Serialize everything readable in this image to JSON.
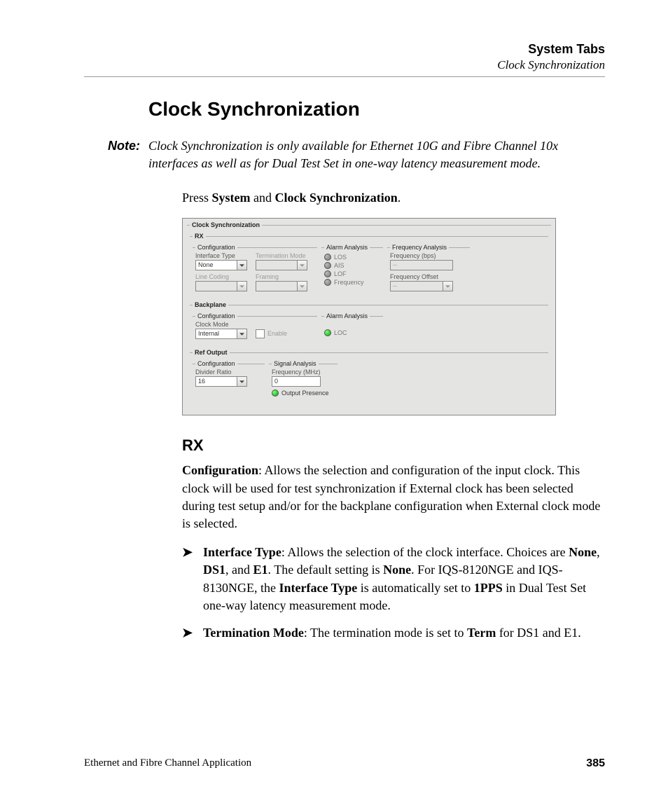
{
  "header": {
    "title": "System Tabs",
    "subtitle": "Clock Synchronization"
  },
  "heading": "Clock Synchronization",
  "note": {
    "label": "Note:",
    "text": "Clock Synchronization is only available for Ethernet 10G and Fibre Channel 10x interfaces as well as for Dual Test Set in one-way latency measurement mode."
  },
  "press": {
    "pre": "Press ",
    "b1": "System",
    "mid": " and ",
    "b2": "Clock Synchronization",
    "post": "."
  },
  "ui": {
    "panel_title": "Clock Synchronization",
    "rx": {
      "title": "RX",
      "config": {
        "legend": "Configuration",
        "interface_type_label": "Interface Type",
        "interface_type_value": "None",
        "termination_mode_label": "Termination Mode",
        "termination_mode_value": "",
        "line_coding_label": "Line Coding",
        "line_coding_value": "",
        "framing_label": "Framing",
        "framing_value": ""
      },
      "alarm": {
        "legend": "Alarm Analysis",
        "items": [
          "LOS",
          "AIS",
          "LOF",
          "Frequency"
        ]
      },
      "freq": {
        "legend": "Frequency Analysis",
        "bps_label": "Frequency (bps)",
        "bps_value": "--",
        "offset_label": "Frequency Offset",
        "offset_value": "--"
      }
    },
    "backplane": {
      "title": "Backplane",
      "config": {
        "legend": "Configuration",
        "clock_mode_label": "Clock Mode",
        "clock_mode_value": "Internal",
        "enable_label": "Enable"
      },
      "alarm": {
        "legend": "Alarm Analysis",
        "item": "LOC"
      }
    },
    "refout": {
      "title": "Ref Output",
      "config": {
        "legend": "Configuration",
        "divider_ratio_label": "Divider Ratio",
        "divider_ratio_value": "16"
      },
      "signal": {
        "legend": "Signal Analysis",
        "freq_label": "Frequency (MHz)",
        "freq_value": "0",
        "presence_label": "Output Presence"
      }
    }
  },
  "rx_section": {
    "title": "RX",
    "config_para_label": "Configuration",
    "config_para_text": ": Allows the selection and configuration of the input clock. This clock will be used for test synchronization if External clock has been selected during test setup and/or for the backplane configuration when External clock mode is selected.",
    "bullets": [
      {
        "b1": "Interface Type",
        "t1": ": Allows the selection of the clock interface. Choices are ",
        "b2": "None",
        "t2": ", ",
        "b3": "DS1",
        "t3": ", and ",
        "b4": "E1",
        "t4": ". The default setting is ",
        "b5": "None",
        "t5": ". For IQS-8120NGE and IQS-8130NGE, the ",
        "b6": "Interface Type",
        "t6": " is automatically set to ",
        "b7": "1PPS",
        "t7": " in Dual Test Set one-way latency measurement mode."
      },
      {
        "b1": "Termination Mode",
        "t1": ": The termination mode is set to ",
        "b2": "Term",
        "t2": " for DS1 and E1."
      }
    ]
  },
  "footer": {
    "left": "Ethernet and Fibre Channel Application",
    "page": "385"
  }
}
